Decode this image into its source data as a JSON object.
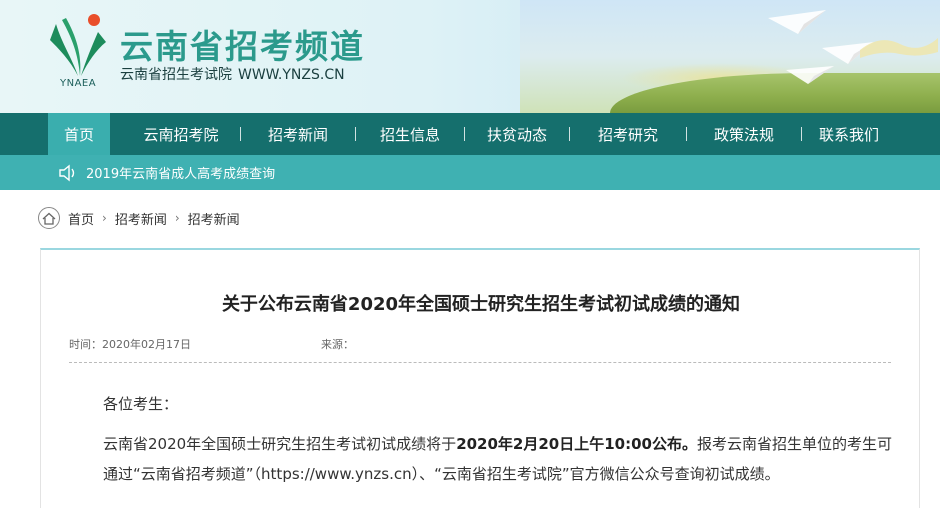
{
  "header": {
    "logo_text": "YNAEA",
    "title": "云南省招考频道",
    "subtitle": "云南省招生考试院",
    "url": "WWW.YNZS.CN"
  },
  "nav": {
    "items": [
      {
        "label": "首页",
        "active": true
      },
      {
        "label": "云南招考院"
      },
      {
        "label": "招考新闻"
      },
      {
        "label": "招生信息"
      },
      {
        "label": "扶贫动态"
      },
      {
        "label": "招考研究"
      },
      {
        "label": "政策法规"
      },
      {
        "label": "联系我们"
      }
    ]
  },
  "notice": {
    "icon": "speaker-icon",
    "text": "2019年云南省成人高考成绩查询"
  },
  "breadcrumb": {
    "items": [
      "首页",
      "招考新闻",
      "招考新闻"
    ]
  },
  "article": {
    "title": "关于公布云南省2020年全国硕士研究生招生考试初试成绩的通知",
    "time_label": "时间：2020年02月17日",
    "source_label": "来源：",
    "greeting": "各位考生：",
    "para_pre": "云南省2020年全国硕士研究生招生考试初试成绩将于",
    "para_bold": "2020年2月20日上午10:00公布。",
    "para_post": "报考云南省招生单位的考生可通过“云南省招考频道”（https://www.ynzs.cn）、“云南省招生考试院”官方微信公众号查询初试成绩。"
  },
  "colors": {
    "nav_bg": "#156f6d",
    "nav_active": "#3aaeae",
    "notice_bg": "#3fb1b2",
    "title_green": "#2b9a8c"
  }
}
